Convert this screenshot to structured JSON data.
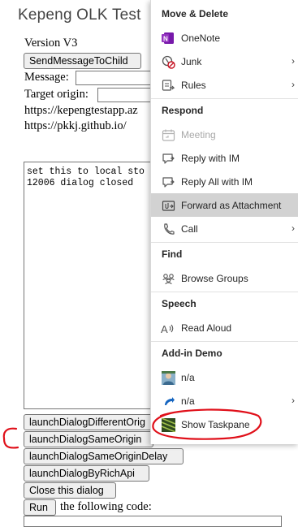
{
  "pane": {
    "title": "Kepeng OLK Test",
    "version": "Version V3",
    "send_button": "SendMessageToChild",
    "message_label": "Message:",
    "target_origin_label": "Target origin:",
    "url_1": "https://kepengtestapp.az",
    "url_2": "https://pkkj.github.io/",
    "log_text": "set this to local sto\n12006 dialog closed",
    "buttons": {
      "launch_different": "launchDialogDifferentOrig",
      "launch_same": "launchDialogSameOrigin",
      "launch_same_delay": "launchDialogSameOriginDelay",
      "launch_rich": "launchDialogByRichApi",
      "close": "Close this dialog",
      "run": "Run"
    },
    "run_suffix": "the following code:"
  },
  "menu": {
    "sections": {
      "move_delete": "Move & Delete",
      "respond": "Respond",
      "find": "Find",
      "speech": "Speech",
      "addin": "Add-in Demo"
    },
    "items": {
      "onenote": {
        "label": "OneNote",
        "icon": "onenote-icon"
      },
      "junk": {
        "label": "Junk",
        "icon": "junk-icon"
      },
      "rules": {
        "label": "Rules",
        "icon": "rules-icon"
      },
      "meeting": {
        "label": "Meeting",
        "icon": "meeting-icon",
        "disabled": true
      },
      "reply_im": {
        "label": "Reply with IM",
        "icon": "chat-icon"
      },
      "reply_all_im": {
        "label": "Reply All with IM",
        "icon": "chat-icon"
      },
      "forward_attachment": {
        "label": "Forward as Attachment",
        "icon": "forward-attachment-icon"
      },
      "call": {
        "label": "Call",
        "icon": "phone-icon"
      },
      "browse_groups": {
        "label": "Browse Groups",
        "icon": "groups-icon"
      },
      "read_aloud": {
        "label": "Read Aloud",
        "icon": "read-aloud-icon"
      },
      "addin_na_1": {
        "label": "n/a",
        "icon": "addin-avatar-icon"
      },
      "addin_na_2": {
        "label": "n/a",
        "icon": "addin-arrow-icon"
      },
      "show_taskpane": {
        "label": "Show Taskpane",
        "icon": "taskpane-thumbnail-icon"
      }
    },
    "chevron": "›"
  },
  "colors": {
    "annotation_red": "#e0101a",
    "onenote_purple": "#7719aa",
    "junk_red": "#c50f1f",
    "selected_bg": "#d2d2d2"
  }
}
